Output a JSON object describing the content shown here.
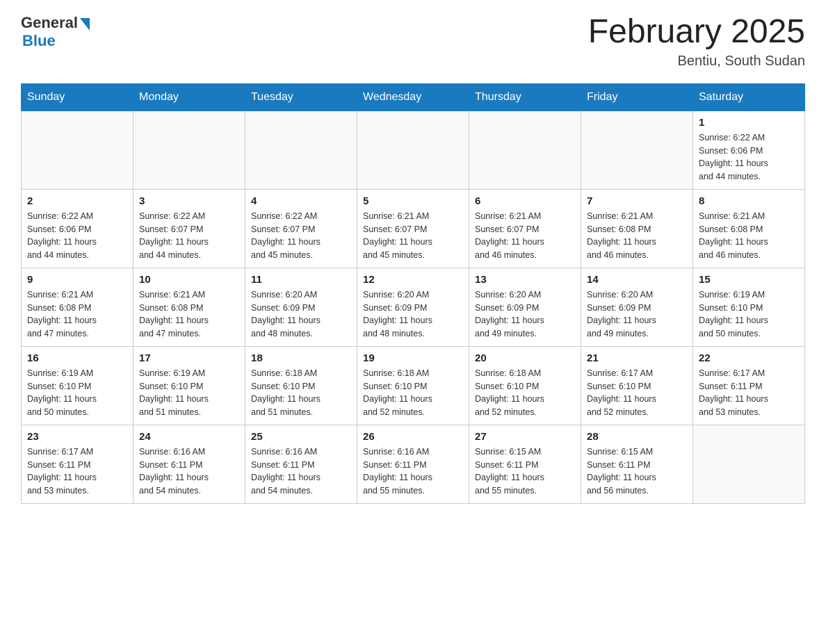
{
  "header": {
    "logo": {
      "general": "General",
      "blue": "Blue"
    },
    "title": "February 2025",
    "location": "Bentiu, South Sudan"
  },
  "days_of_week": [
    "Sunday",
    "Monday",
    "Tuesday",
    "Wednesday",
    "Thursday",
    "Friday",
    "Saturday"
  ],
  "weeks": [
    [
      {
        "num": "",
        "info": ""
      },
      {
        "num": "",
        "info": ""
      },
      {
        "num": "",
        "info": ""
      },
      {
        "num": "",
        "info": ""
      },
      {
        "num": "",
        "info": ""
      },
      {
        "num": "",
        "info": ""
      },
      {
        "num": "1",
        "info": "Sunrise: 6:22 AM\nSunset: 6:06 PM\nDaylight: 11 hours\nand 44 minutes."
      }
    ],
    [
      {
        "num": "2",
        "info": "Sunrise: 6:22 AM\nSunset: 6:06 PM\nDaylight: 11 hours\nand 44 minutes."
      },
      {
        "num": "3",
        "info": "Sunrise: 6:22 AM\nSunset: 6:07 PM\nDaylight: 11 hours\nand 44 minutes."
      },
      {
        "num": "4",
        "info": "Sunrise: 6:22 AM\nSunset: 6:07 PM\nDaylight: 11 hours\nand 45 minutes."
      },
      {
        "num": "5",
        "info": "Sunrise: 6:21 AM\nSunset: 6:07 PM\nDaylight: 11 hours\nand 45 minutes."
      },
      {
        "num": "6",
        "info": "Sunrise: 6:21 AM\nSunset: 6:07 PM\nDaylight: 11 hours\nand 46 minutes."
      },
      {
        "num": "7",
        "info": "Sunrise: 6:21 AM\nSunset: 6:08 PM\nDaylight: 11 hours\nand 46 minutes."
      },
      {
        "num": "8",
        "info": "Sunrise: 6:21 AM\nSunset: 6:08 PM\nDaylight: 11 hours\nand 46 minutes."
      }
    ],
    [
      {
        "num": "9",
        "info": "Sunrise: 6:21 AM\nSunset: 6:08 PM\nDaylight: 11 hours\nand 47 minutes."
      },
      {
        "num": "10",
        "info": "Sunrise: 6:21 AM\nSunset: 6:08 PM\nDaylight: 11 hours\nand 47 minutes."
      },
      {
        "num": "11",
        "info": "Sunrise: 6:20 AM\nSunset: 6:09 PM\nDaylight: 11 hours\nand 48 minutes."
      },
      {
        "num": "12",
        "info": "Sunrise: 6:20 AM\nSunset: 6:09 PM\nDaylight: 11 hours\nand 48 minutes."
      },
      {
        "num": "13",
        "info": "Sunrise: 6:20 AM\nSunset: 6:09 PM\nDaylight: 11 hours\nand 49 minutes."
      },
      {
        "num": "14",
        "info": "Sunrise: 6:20 AM\nSunset: 6:09 PM\nDaylight: 11 hours\nand 49 minutes."
      },
      {
        "num": "15",
        "info": "Sunrise: 6:19 AM\nSunset: 6:10 PM\nDaylight: 11 hours\nand 50 minutes."
      }
    ],
    [
      {
        "num": "16",
        "info": "Sunrise: 6:19 AM\nSunset: 6:10 PM\nDaylight: 11 hours\nand 50 minutes."
      },
      {
        "num": "17",
        "info": "Sunrise: 6:19 AM\nSunset: 6:10 PM\nDaylight: 11 hours\nand 51 minutes."
      },
      {
        "num": "18",
        "info": "Sunrise: 6:18 AM\nSunset: 6:10 PM\nDaylight: 11 hours\nand 51 minutes."
      },
      {
        "num": "19",
        "info": "Sunrise: 6:18 AM\nSunset: 6:10 PM\nDaylight: 11 hours\nand 52 minutes."
      },
      {
        "num": "20",
        "info": "Sunrise: 6:18 AM\nSunset: 6:10 PM\nDaylight: 11 hours\nand 52 minutes."
      },
      {
        "num": "21",
        "info": "Sunrise: 6:17 AM\nSunset: 6:10 PM\nDaylight: 11 hours\nand 52 minutes."
      },
      {
        "num": "22",
        "info": "Sunrise: 6:17 AM\nSunset: 6:11 PM\nDaylight: 11 hours\nand 53 minutes."
      }
    ],
    [
      {
        "num": "23",
        "info": "Sunrise: 6:17 AM\nSunset: 6:11 PM\nDaylight: 11 hours\nand 53 minutes."
      },
      {
        "num": "24",
        "info": "Sunrise: 6:16 AM\nSunset: 6:11 PM\nDaylight: 11 hours\nand 54 minutes."
      },
      {
        "num": "25",
        "info": "Sunrise: 6:16 AM\nSunset: 6:11 PM\nDaylight: 11 hours\nand 54 minutes."
      },
      {
        "num": "26",
        "info": "Sunrise: 6:16 AM\nSunset: 6:11 PM\nDaylight: 11 hours\nand 55 minutes."
      },
      {
        "num": "27",
        "info": "Sunrise: 6:15 AM\nSunset: 6:11 PM\nDaylight: 11 hours\nand 55 minutes."
      },
      {
        "num": "28",
        "info": "Sunrise: 6:15 AM\nSunset: 6:11 PM\nDaylight: 11 hours\nand 56 minutes."
      },
      {
        "num": "",
        "info": ""
      }
    ]
  ]
}
